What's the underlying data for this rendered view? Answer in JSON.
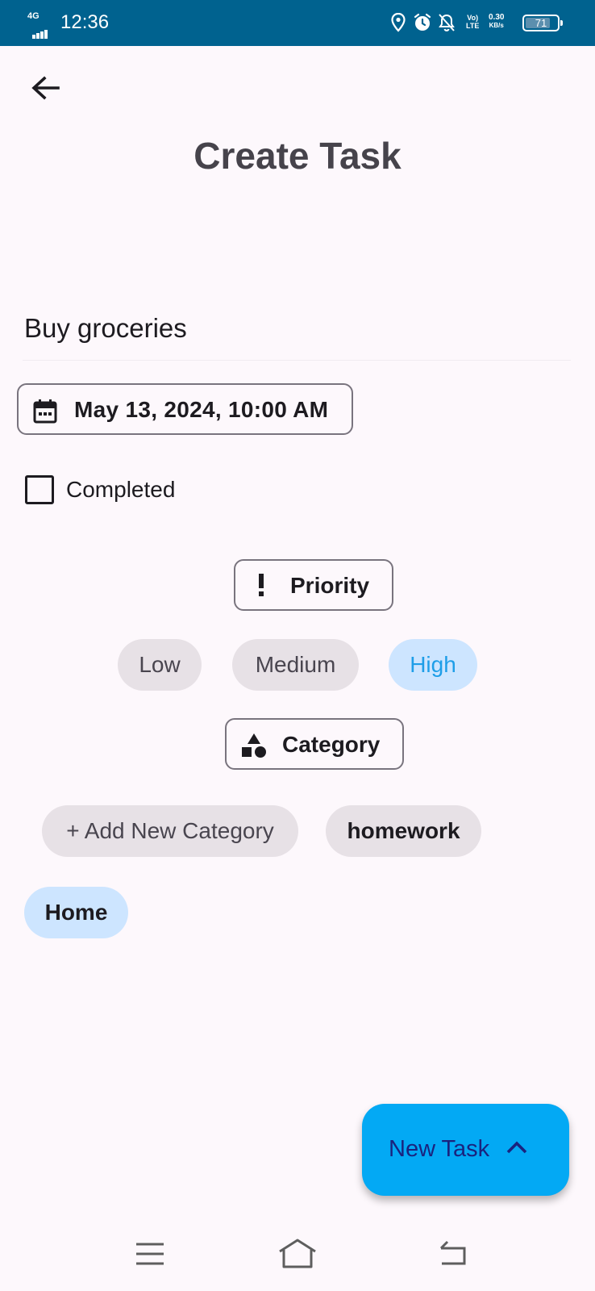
{
  "status_bar": {
    "network": "4G",
    "time": "12:36",
    "volte_top": "Vo)",
    "volte_bottom": "LTE",
    "speed_value": "0.30",
    "speed_unit": "KB/s",
    "battery_level": "71",
    "icons": [
      "location-icon",
      "alarm-icon",
      "notifications-off-icon"
    ]
  },
  "header": {
    "back_icon": "arrow-back-icon",
    "title": "Create Task"
  },
  "form": {
    "task_name": "Buy groceries",
    "date_button": {
      "icon": "calendar-icon",
      "label": "May 13, 2024, 10:00 AM"
    },
    "completed": {
      "label": "Completed",
      "checked": false
    },
    "priority": {
      "button_label": "Priority",
      "button_icon": "priority-exclamation-icon",
      "options": [
        {
          "label": "Low",
          "selected": false
        },
        {
          "label": "Medium",
          "selected": false
        },
        {
          "label": "High",
          "selected": true
        }
      ]
    },
    "category": {
      "button_label": "Category",
      "button_icon": "category-shapes-icon",
      "options": [
        {
          "label": "+ Add New Category",
          "selected": false
        },
        {
          "label": "homework",
          "selected": false
        },
        {
          "label": "Home",
          "selected": true
        }
      ]
    }
  },
  "fab": {
    "label": "New Task",
    "icon": "chevron-up-icon"
  },
  "nav_bar": {
    "icons": [
      "menu-icon",
      "home-icon",
      "back-nav-icon"
    ]
  },
  "colors": {
    "status_bar": "#00628f",
    "background": "#fdf8fc",
    "fab": "#03a9f4",
    "fab_text": "#1a237e",
    "chip": "#e7e1e6",
    "chip_selected": "#cde5ff",
    "chip_selected_text": "#1e9ee8"
  }
}
